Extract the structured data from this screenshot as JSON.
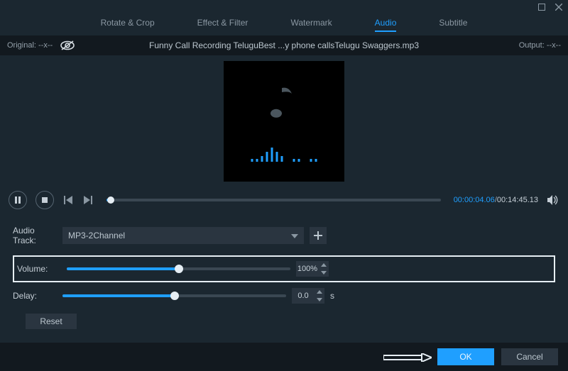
{
  "window": {
    "tabs": [
      "Rotate & Crop",
      "Effect & Filter",
      "Watermark",
      "Audio",
      "Subtitle"
    ],
    "active_tab_index": 3
  },
  "info": {
    "original_label": "Original:",
    "original_value": "--x--",
    "filename": "Funny Call Recording TeluguBest ...y phone callsTelugu Swaggers.mp3",
    "output_label": "Output:",
    "output_value": "--x--"
  },
  "playback": {
    "current_time": "00:00:04.06",
    "total_time": "00:14:45.13",
    "progress_percent": 1.2
  },
  "form": {
    "audio_track_label": "Audio Track:",
    "audio_track_value": "MP3-2Channel",
    "volume_label": "Volume:",
    "volume_value": "100%",
    "volume_percent": 50,
    "delay_label": "Delay:",
    "delay_value": "0.0",
    "delay_unit": "s",
    "delay_percent": 50,
    "reset_label": "Reset"
  },
  "footer": {
    "ok_label": "OK",
    "cancel_label": "Cancel"
  }
}
